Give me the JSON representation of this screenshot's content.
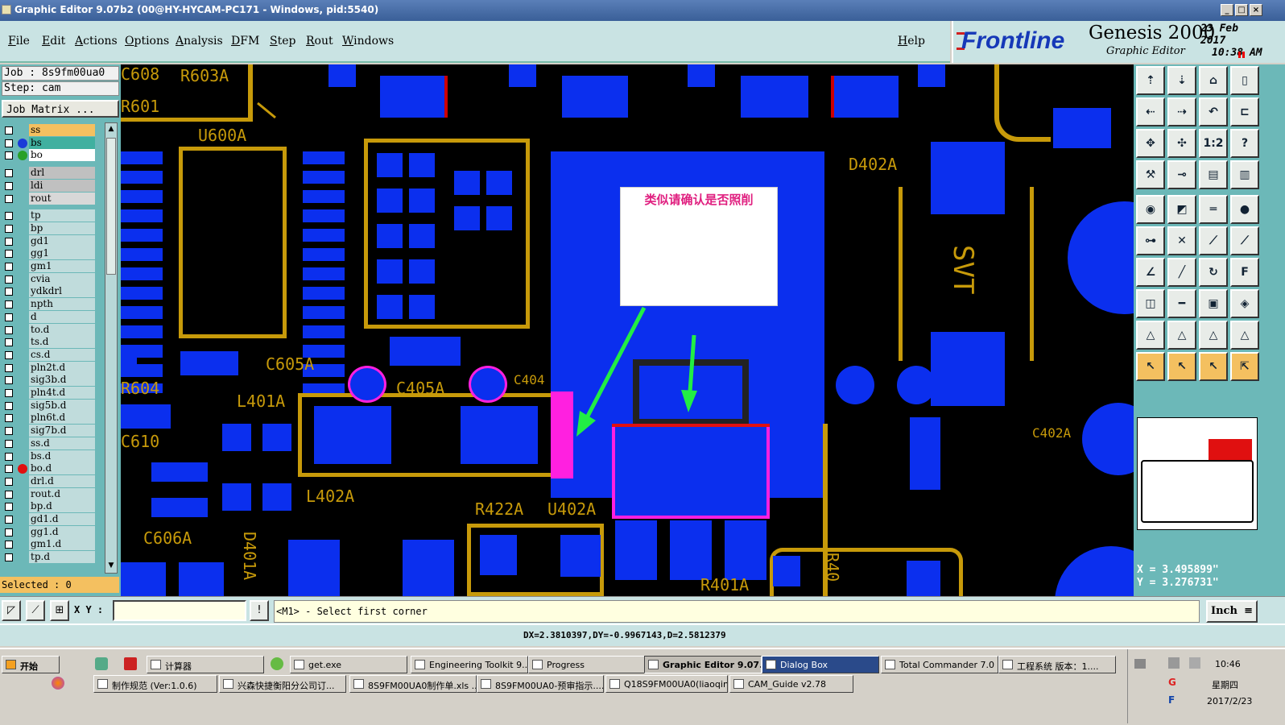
{
  "window": {
    "title": "Graphic Editor 9.07b2 (00@HY-HYCAM-PC171 - Windows, pid:5540)"
  },
  "menu": [
    "File",
    "Edit",
    "Actions",
    "Options",
    "Analysis",
    "DFM",
    "Step",
    "Rout",
    "Windows"
  ],
  "help": "Help",
  "brand": {
    "frontline": "Frontline",
    "product": "Genesis 2000",
    "subtitle": "Graphic Editor",
    "date_line1": "23 Feb 2017",
    "date_line2": "10:38 AM"
  },
  "job": {
    "job": "Job : 8s9fm00ua0",
    "step": "Step: cam",
    "matrix_button": "Job Matrix ..."
  },
  "layers": [
    {
      "name": "ss",
      "color": "#f4c060",
      "dot": ""
    },
    {
      "name": "bs",
      "color": "#40b0a0",
      "dot": "#1a3cd8"
    },
    {
      "name": "bo",
      "color": "#ffffff",
      "dot": "#28a028"
    },
    {
      "name": "drl",
      "color": "#c0c0c0",
      "dot": ""
    },
    {
      "name": "ldi",
      "color": "#c0c0c0",
      "dot": ""
    },
    {
      "name": "rout",
      "color": "#d8d8d8",
      "dot": ""
    },
    {
      "name": "tp",
      "color": "#c0dcdc",
      "dot": ""
    },
    {
      "name": "bp",
      "color": "#c0dcdc",
      "dot": ""
    },
    {
      "name": "gd1",
      "color": "#c0dcdc",
      "dot": ""
    },
    {
      "name": "gg1",
      "color": "#c0dcdc",
      "dot": ""
    },
    {
      "name": "gm1",
      "color": "#c0dcdc",
      "dot": ""
    },
    {
      "name": "cvia",
      "color": "#c0dcdc",
      "dot": ""
    },
    {
      "name": "ydkdrl",
      "color": "#c0dcdc",
      "dot": ""
    },
    {
      "name": "npth",
      "color": "#c0dcdc",
      "dot": ""
    },
    {
      "name": "d",
      "color": "#c0dcdc",
      "dot": ""
    },
    {
      "name": "to.d",
      "color": "#c0dcdc",
      "dot": ""
    },
    {
      "name": "ts.d",
      "color": "#c0dcdc",
      "dot": ""
    },
    {
      "name": "cs.d",
      "color": "#c0dcdc",
      "dot": ""
    },
    {
      "name": "pln2t.d",
      "color": "#c0dcdc",
      "dot": ""
    },
    {
      "name": "sig3b.d",
      "color": "#c0dcdc",
      "dot": ""
    },
    {
      "name": "pln4t.d",
      "color": "#c0dcdc",
      "dot": ""
    },
    {
      "name": "sig5b.d",
      "color": "#c0dcdc",
      "dot": ""
    },
    {
      "name": "pln6t.d",
      "color": "#c0dcdc",
      "dot": ""
    },
    {
      "name": "sig7b.d",
      "color": "#c0dcdc",
      "dot": ""
    },
    {
      "name": "ss.d",
      "color": "#c0dcdc",
      "dot": ""
    },
    {
      "name": "bs.d",
      "color": "#c0dcdc",
      "dot": ""
    },
    {
      "name": "bo.d",
      "color": "#c0dcdc",
      "dot": "#e01010"
    },
    {
      "name": "drl.d",
      "color": "#c0dcdc",
      "dot": ""
    },
    {
      "name": "rout.d",
      "color": "#c0dcdc",
      "dot": ""
    },
    {
      "name": "bp.d",
      "color": "#c0dcdc",
      "dot": ""
    },
    {
      "name": "gd1.d",
      "color": "#c0dcdc",
      "dot": ""
    },
    {
      "name": "gg1.d",
      "color": "#c0dcdc",
      "dot": ""
    },
    {
      "name": "gm1.d",
      "color": "#c0dcdc",
      "dot": ""
    },
    {
      "name": "tp.d",
      "color": "#c0dcdc",
      "dot": ""
    }
  ],
  "selected": "Selected : 0",
  "canvas": {
    "note": "类似请确认是否照削",
    "silk_labels": [
      "R603A",
      "C608",
      "R601",
      "U600A",
      "D402A",
      "C605A",
      "R604",
      "L401A",
      "C405A",
      "C404",
      "C610",
      "L402A",
      "R422A",
      "U402A",
      "C606A",
      "D401A",
      "R401A",
      "C402A",
      "SVT",
      "R40"
    ]
  },
  "coords": {
    "x": "X = 3.495899\"",
    "y": "Y = 3.276731\""
  },
  "cmd": {
    "xy_label": "X Y :",
    "xy_value": "",
    "prompt": "<M1> - Select first corner",
    "unit": "Inch"
  },
  "status": {
    "dxdy": "DX=2.3810397,DY=-0.9967143,D=2.5812379"
  },
  "taskbar": {
    "start": "开始",
    "row1": [
      "计算器",
      "get.exe",
      "Engineering Toolkit 9....",
      "Progress",
      "Graphic Editor 9.07...",
      "Dialog Box",
      "Total Commander 7.0 ...",
      "工程系统  版本：1...."
    ],
    "row2": [
      "制作规范 (Ver:1.0.6)",
      "兴森快捷衡阳分公司订...",
      "8S9FM00UA0制作单.xls ...",
      "8S9FM00UA0-预审指示....",
      "Q18S9FM00UA0(liaoqing....",
      "CAM_Guide v2.78"
    ],
    "clock": "10:46",
    "weekday": "星期四",
    "date": "2017/2/23"
  }
}
